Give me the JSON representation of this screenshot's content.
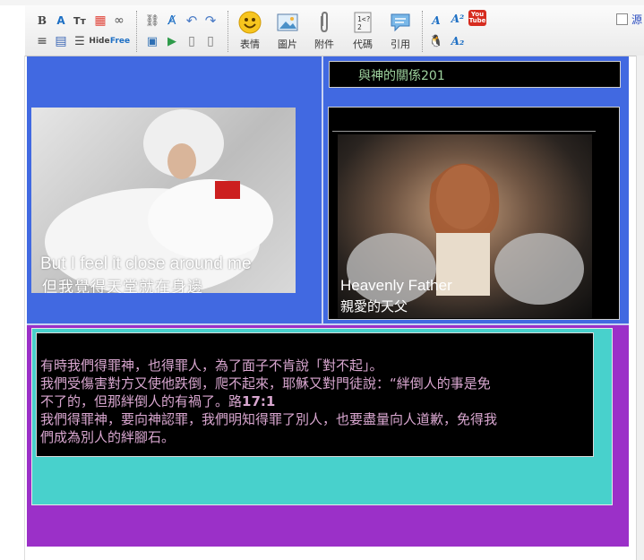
{
  "window": {
    "partial_title": "— — — —"
  },
  "toolbar": {
    "row1": [
      {
        "name": "bold-button",
        "glyph": "B"
      },
      {
        "name": "font-color-button",
        "glyph": "A"
      },
      {
        "name": "font-size-button",
        "glyph": "Tт"
      },
      {
        "name": "color-grid-button",
        "glyph": "▦"
      },
      {
        "name": "link-button",
        "glyph": "∞"
      }
    ],
    "row2": [
      {
        "name": "align-left-button",
        "glyph": "≡"
      },
      {
        "name": "table-button",
        "glyph": "▤"
      },
      {
        "name": "list-button",
        "glyph": "☰"
      },
      {
        "name": "hide-button",
        "glyph": "Hide"
      },
      {
        "name": "free-button",
        "glyph": "Free"
      }
    ],
    "group2_row1": [
      {
        "name": "unlink-button",
        "glyph": "⛓"
      },
      {
        "name": "clear-format-button",
        "glyph": "A̸"
      },
      {
        "name": "undo-button",
        "glyph": "↶"
      },
      {
        "name": "redo-button",
        "glyph": "↷"
      }
    ],
    "group2_row2": [
      {
        "name": "insert-flash-button",
        "glyph": "▣"
      },
      {
        "name": "insert-media-button",
        "glyph": "▶"
      },
      {
        "name": "page-button",
        "glyph": "▯"
      },
      {
        "name": "doc-button",
        "glyph": "▯"
      }
    ],
    "big": [
      {
        "name": "emoticon-button",
        "label": "表情",
        "icon": "smiley-icon"
      },
      {
        "name": "image-button",
        "label": "圖片",
        "icon": "picture-icon"
      },
      {
        "name": "attach-button",
        "label": "附件",
        "icon": "paperclip-icon"
      },
      {
        "name": "code-button",
        "label": "代碼",
        "icon": "code-icon"
      },
      {
        "name": "quote-button",
        "label": "引用",
        "icon": "speech-bubble-icon"
      }
    ],
    "youtube_label": "You Tube",
    "source_label": "源"
  },
  "post": {
    "title": "與神的關係201",
    "photo1_caption_en": "But I feel it close around me",
    "photo1_caption_zh": "但我覺得天堂就在身邊",
    "photo2_caption_en": "Heavenly Father",
    "photo2_caption_zh": "親愛的天父",
    "lines": [
      "有時我們得罪神，也得罪人，為了面子不肯說「對不起」。",
      "我們受傷害對方又使他跌倒，爬不起來，耶穌又對門徒說：“絆倒人的事是免",
      "不了的，但那絆倒人的有禍了。路",
      "17:1",
      "我們得罪神，要向神認罪，我們明知得罪了別人，也要盡量向人道歉，免得我",
      "們成為別人的絆腳石。"
    ]
  },
  "colors": {
    "blue": "#4169e1",
    "purple": "#9b30c8",
    "teal": "#48d1cc",
    "text": "#d8a6cf",
    "title_text": "#9ed29e"
  }
}
